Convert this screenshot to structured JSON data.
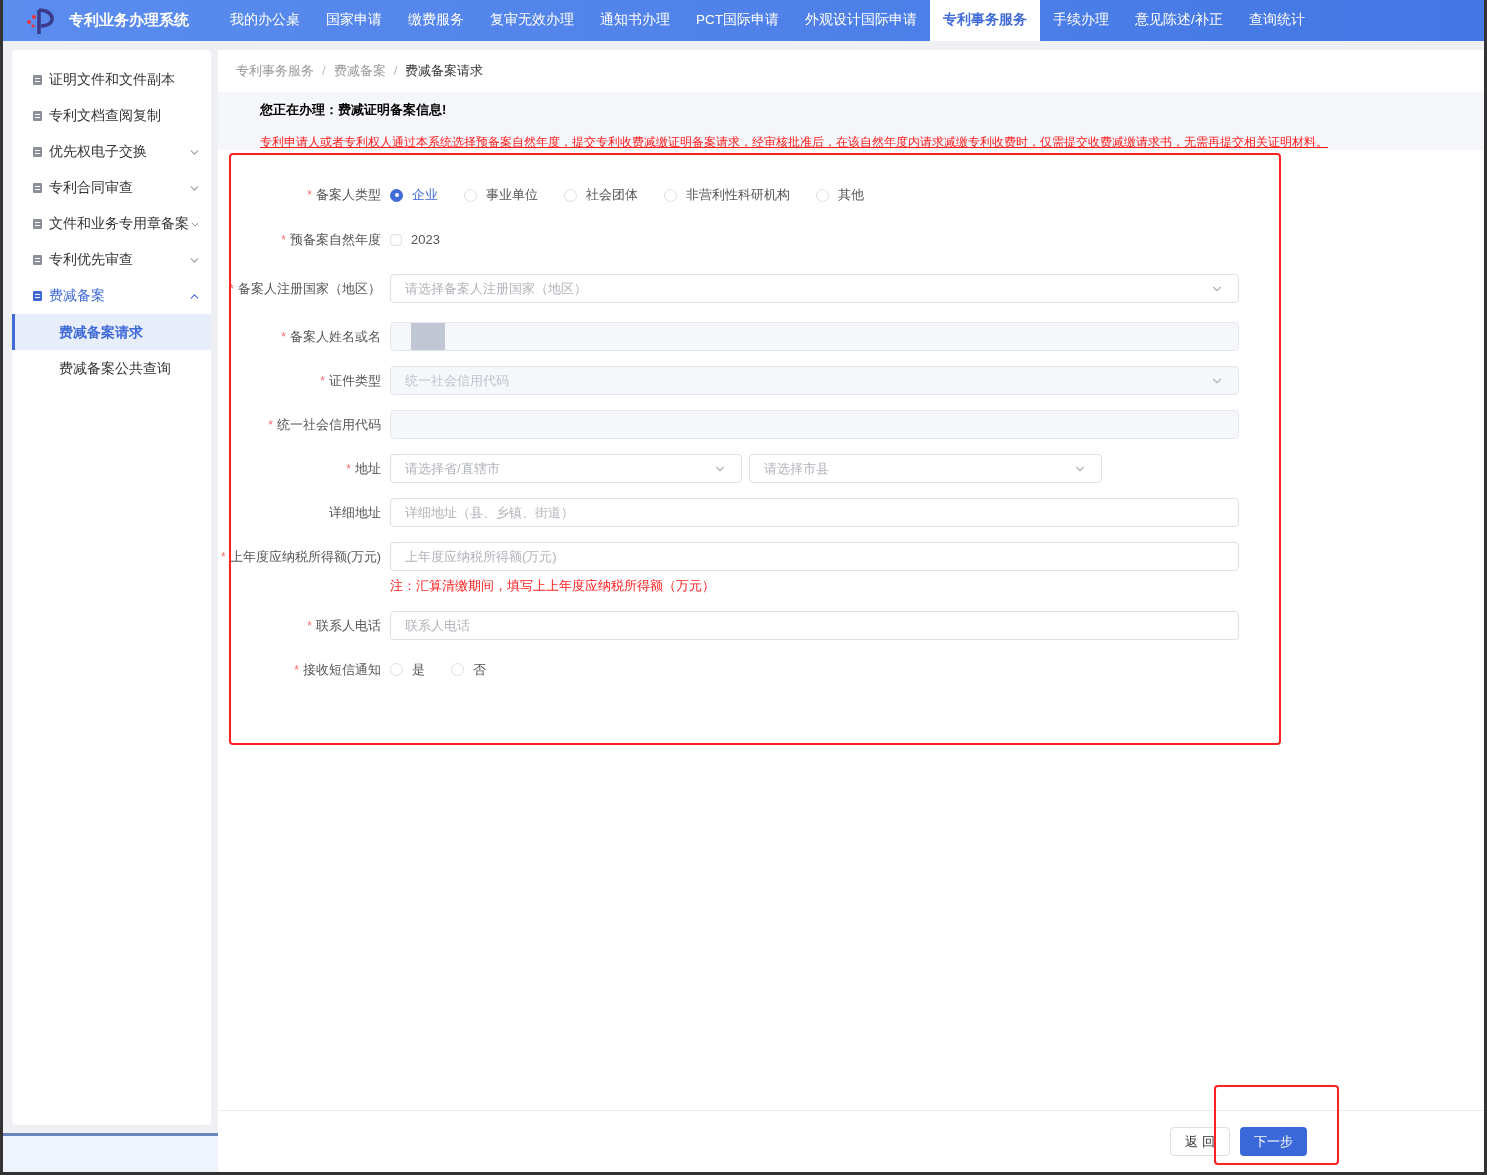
{
  "app": {
    "title": "专利业务办理系统"
  },
  "required_mark": "*",
  "nav": [
    {
      "label": "我的办公桌",
      "selected": false
    },
    {
      "label": "国家申请",
      "selected": false
    },
    {
      "label": "缴费服务",
      "selected": false
    },
    {
      "label": "复审无效办理",
      "selected": false
    },
    {
      "label": "通知书办理",
      "selected": false
    },
    {
      "label": "PCT国际申请",
      "selected": false
    },
    {
      "label": "外观设计国际申请",
      "selected": false
    },
    {
      "label": "专利事务服务",
      "selected": true
    },
    {
      "label": "手续办理",
      "selected": false
    },
    {
      "label": "意见陈述/补正",
      "selected": false
    },
    {
      "label": "查询统计",
      "selected": false
    }
  ],
  "sidebar": {
    "items": [
      {
        "label": "证明文件和文件副本",
        "has_arrow": false,
        "selected": false
      },
      {
        "label": "专利文档查阅复制",
        "has_arrow": false,
        "selected": false
      },
      {
        "label": "优先权电子交换",
        "has_arrow": true,
        "expanded": false,
        "selected": false
      },
      {
        "label": "专利合同审查",
        "has_arrow": true,
        "expanded": false,
        "selected": false
      },
      {
        "label": "文件和业务专用章备案",
        "has_arrow": true,
        "expanded": false,
        "selected": false
      },
      {
        "label": "专利优先审查",
        "has_arrow": true,
        "expanded": false,
        "selected": false
      },
      {
        "label": "费减备案",
        "has_arrow": true,
        "expanded": true,
        "selected": true,
        "children": [
          {
            "label": "费减备案请求",
            "selected": true
          },
          {
            "label": "费减备案公共查询",
            "selected": false
          }
        ]
      }
    ]
  },
  "breadcrumb": [
    {
      "label": "专利事务服务"
    },
    {
      "separator": "/",
      "label": "费减备案"
    },
    {
      "separator": "/",
      "label": "费减备案请求"
    }
  ],
  "notice": {
    "title": "您正在办理：费减证明备案信息!",
    "text": "专利申请人或者专利权人通过本系统选择预备案自然年度，提交专利收费减缴证明备案请求，经审核批准后，在该自然年度内请求减缴专利收费时，仅需提交收费减缴请求书，无需再提交相关证明材料。"
  },
  "form": [
    {
      "kind": "radio",
      "label": "备案人类型",
      "required": true,
      "options": [
        {
          "label": "企业",
          "selected": true
        },
        {
          "label": "事业单位",
          "selected": false
        },
        {
          "label": "社会团体",
          "selected": false
        },
        {
          "label": "非营利性科研机构",
          "selected": false
        },
        {
          "label": "其他",
          "selected": false
        }
      ]
    },
    {
      "kind": "checkbox",
      "label": "预备案自然年度",
      "required": true,
      "options": [
        {
          "label": "2023",
          "checked": false
        }
      ]
    },
    {
      "kind": "select",
      "label": "备案人注册国家（地区）",
      "required": true,
      "placeholder": "请选择备案人注册国家（地区）",
      "disabled": false
    },
    {
      "kind": "input",
      "label": "备案人姓名或名",
      "required": true,
      "disabled": true,
      "obscured": true
    },
    {
      "kind": "select",
      "label": "证件类型",
      "required": true,
      "placeholder": "统一社会信用代码",
      "disabled": true
    },
    {
      "kind": "input",
      "label": "统一社会信用代码",
      "required": true,
      "disabled": true
    },
    {
      "kind": "address",
      "label": "地址",
      "required": true,
      "placeholders": [
        "请选择省/直辖市",
        "请选择市县"
      ]
    },
    {
      "kind": "input",
      "label": "详细地址",
      "required": false,
      "placeholder": "详细地址（县、乡镇、街道）",
      "disabled": false
    },
    {
      "kind": "input",
      "label": "上年度应纳税所得额(万元)",
      "required": true,
      "placeholder": "上年度应纳税所得额(万元)",
      "disabled": false,
      "note": "注：汇算清缴期间，填写上上年度应纳税所得额（万元）"
    },
    {
      "kind": "input",
      "label": "联系人电话",
      "required": true,
      "placeholder": "联系人电话",
      "disabled": false
    },
    {
      "kind": "radio",
      "label": "接收短信通知",
      "required": true,
      "options": [
        {
          "label": "是",
          "selected": false
        },
        {
          "label": "否",
          "selected": false
        }
      ]
    }
  ],
  "footer": {
    "buttons": [
      {
        "label": "返 回",
        "kind": "default"
      },
      {
        "label": "下一步",
        "kind": "primary"
      }
    ]
  }
}
